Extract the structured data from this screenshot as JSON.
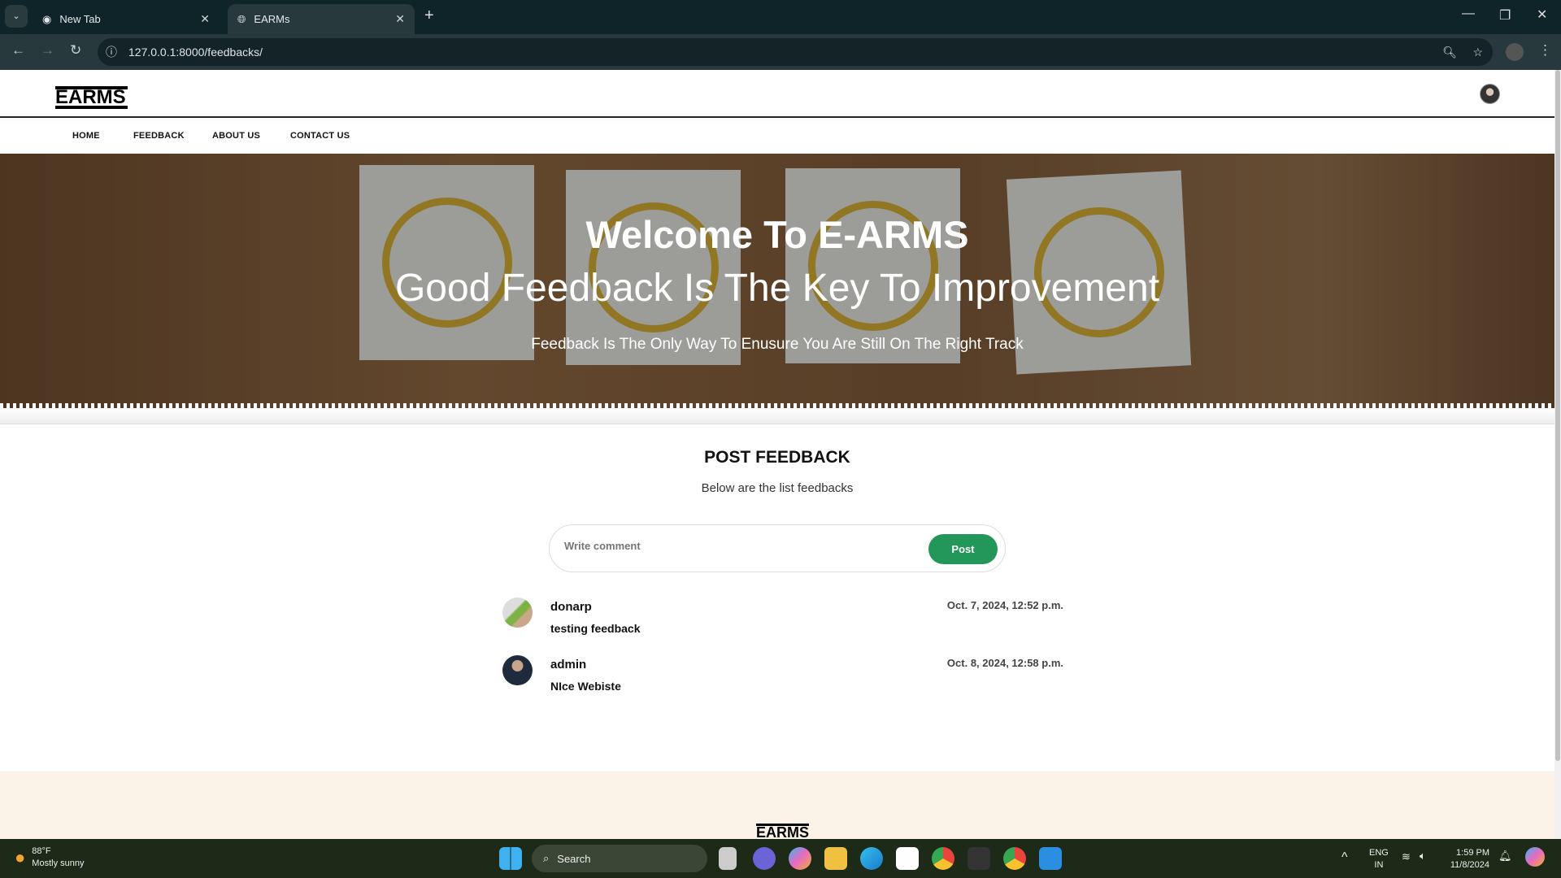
{
  "browser": {
    "tabs": [
      {
        "label": "New Tab",
        "active": false
      },
      {
        "label": "EARMs",
        "active": true
      }
    ],
    "url": "127.0.0.1:8000/feedbacks/"
  },
  "site": {
    "logo": "EARMS",
    "nav": [
      "HOME",
      "FEEDBACK",
      "ABOUT US",
      "CONTACT US"
    ],
    "hero": {
      "title": "Welcome To E-ARMS",
      "subtitle": "Good Feedback Is The Key To Improvement",
      "tagline": "Feedback Is The Only Way To Enusure You Are Still On The Right Track"
    },
    "section": {
      "title": "POST FEEDBACK",
      "subtitle": "Below are the list feedbacks"
    },
    "comment": {
      "placeholder": "Write comment",
      "value": "",
      "post_label": "Post"
    },
    "feedbacks": [
      {
        "user": "donarp",
        "date": "Oct. 7, 2024, 12:52 p.m.",
        "text": "testing feedback"
      },
      {
        "user": "admin",
        "date": "Oct. 8, 2024, 12:58 p.m.",
        "text": "NIce Webiste"
      }
    ],
    "footer_logo": "EARMS",
    "colors": {
      "accent": "#23965a",
      "footer": "#fbf3e8"
    }
  },
  "taskbar": {
    "weather": {
      "temp": "88°F",
      "desc": "Mostly sunny"
    },
    "search": "Search",
    "lang": "ENG",
    "region": "IN",
    "time": "1:59 PM",
    "date": "11/8/2024"
  }
}
